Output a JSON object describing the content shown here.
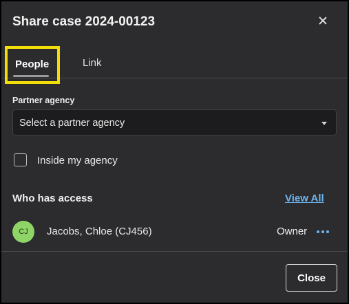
{
  "dialog": {
    "title": "Share case 2024-00123",
    "close_icon": "close-icon"
  },
  "tabs": [
    {
      "label": "People",
      "selected": true
    },
    {
      "label": "Link",
      "selected": false
    }
  ],
  "partner_agency": {
    "label": "Partner agency",
    "placeholder": "Select a partner agency",
    "dropdown_icon": "chevron-down-icon"
  },
  "inside_agency": {
    "label": "Inside my agency",
    "checked": false
  },
  "access": {
    "heading": "Who has access",
    "view_all_label": "View All",
    "people": [
      {
        "initials": "CJ",
        "name": "Jacobs, Chloe (CJ456)",
        "role": "Owner",
        "avatar_color": "#8fd467",
        "menu_icon": "more-horizontal-icon"
      }
    ]
  },
  "footer": {
    "close_label": "Close"
  },
  "colors": {
    "dialog_bg": "#2c2c2e",
    "accent_link": "#6cb4ee",
    "highlight": "#f2de06"
  }
}
